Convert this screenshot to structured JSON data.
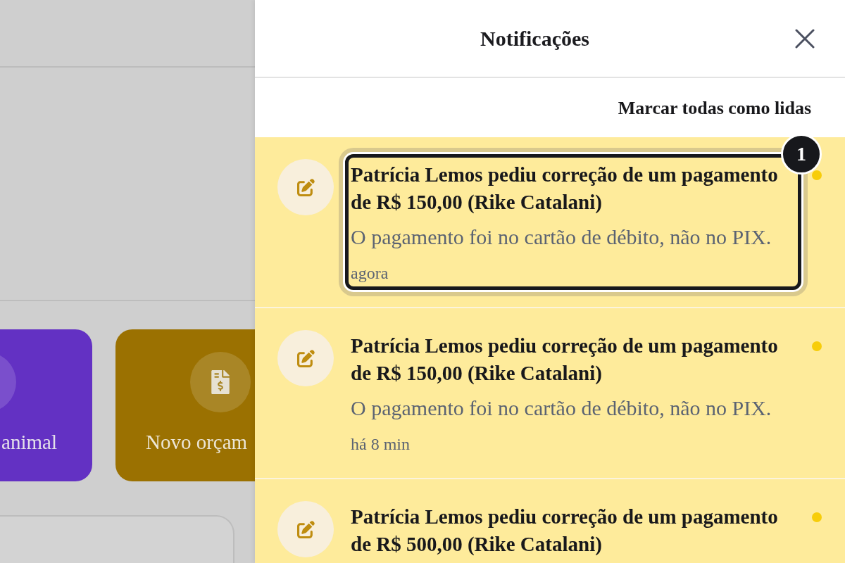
{
  "background_page": {
    "shortcuts": [
      {
        "label": "animal",
        "color": "#6331c3"
      },
      {
        "label": "Novo orçam",
        "color": "#9b7101"
      }
    ]
  },
  "notifications_panel": {
    "title": "Notificações",
    "mark_all_read": "Marcar todas como lidas",
    "tour_badge": "1",
    "notifications": [
      {
        "title": "Patrícia Lemos pediu correção de um pagamento de R$ 150,00 (Rike Catalani)",
        "message": "O pagamento foi no cartão de débito, não no PIX.",
        "time": "agora",
        "unread": true,
        "highlighted": true
      },
      {
        "title": "Patrícia Lemos pediu correção de um pagamento de R$ 150,00 (Rike Catalani)",
        "message": "O pagamento foi no cartão de débito, não no PIX.",
        "time": "há 8 min",
        "unread": true,
        "highlighted": false
      },
      {
        "title": "Patrícia Lemos pediu correção de um pagamento de R$ 500,00 (Rike Catalani)",
        "unread": true,
        "highlighted": false
      }
    ]
  }
}
